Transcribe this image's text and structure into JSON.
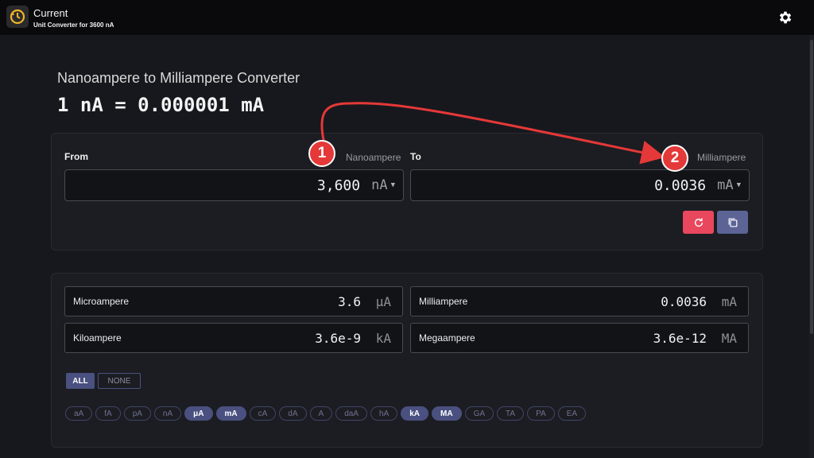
{
  "header": {
    "title": "Current",
    "subtitle": "Unit Converter for 3600 nA",
    "logo_icon": "current-clock-icon",
    "settings_icon": "gear-icon"
  },
  "main": {
    "heading": "Nanoampere to Milliampere Converter",
    "formula": "1 nA = 0.000001 mA"
  },
  "converter": {
    "from_label": "From",
    "from_unit_name": "Nanoampere",
    "from_value": "3,600",
    "from_unit": "nA",
    "to_label": "To",
    "to_unit_name": "Milliampere",
    "to_value": "0.0036",
    "to_unit": "mA",
    "reset_icon": "refresh-icon",
    "copy_icon": "copy-icon",
    "reset_color": "#e8475d",
    "copy_color": "#5b6495"
  },
  "results": [
    {
      "name": "Microampere",
      "value": "3.6",
      "unit": "μA"
    },
    {
      "name": "Milliampere",
      "value": "0.0036",
      "unit": "mA"
    },
    {
      "name": "Kiloampere",
      "value": "3.6e-9",
      "unit": "kA"
    },
    {
      "name": "Megaampere",
      "value": "3.6e-12",
      "unit": "MA"
    }
  ],
  "filters": {
    "all_label": "ALL",
    "none_label": "NONE"
  },
  "chips": [
    {
      "label": "aA",
      "active": false
    },
    {
      "label": "fA",
      "active": false
    },
    {
      "label": "pA",
      "active": false
    },
    {
      "label": "nA",
      "active": false
    },
    {
      "label": "μA",
      "active": true
    },
    {
      "label": "mA",
      "active": true
    },
    {
      "label": "cA",
      "active": false
    },
    {
      "label": "dA",
      "active": false
    },
    {
      "label": "A",
      "active": false
    },
    {
      "label": "daA",
      "active": false
    },
    {
      "label": "hA",
      "active": false
    },
    {
      "label": "kA",
      "active": true
    },
    {
      "label": "MA",
      "active": true
    },
    {
      "label": "GA",
      "active": false
    },
    {
      "label": "TA",
      "active": false
    },
    {
      "label": "PA",
      "active": false
    },
    {
      "label": "EA",
      "active": false
    }
  ],
  "annotations": {
    "marker_1": "1",
    "marker_2": "2",
    "marker_color": "#e53838"
  },
  "colors": {
    "accent": "#4a5180",
    "background": "#17181d"
  }
}
